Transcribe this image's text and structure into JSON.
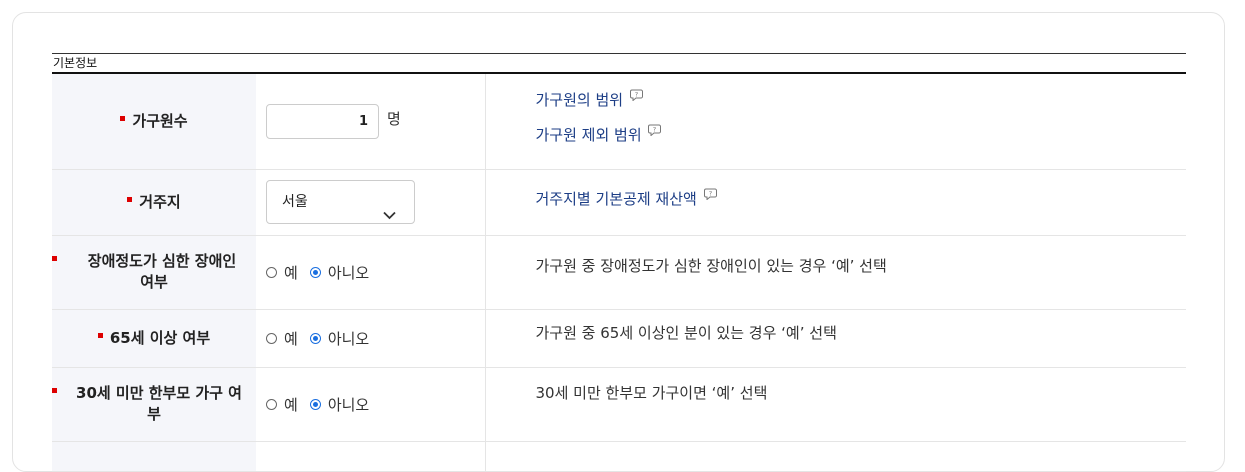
{
  "section": {
    "title": "기본정보"
  },
  "rows": [
    {
      "label": "가구원수",
      "value": "1",
      "unit": "명",
      "links": [
        "가구원의 범위",
        "가구원 제외 범위"
      ]
    },
    {
      "label": "거주지",
      "selected": "서울",
      "links": [
        "거주지별 기본공제 재산액"
      ]
    },
    {
      "label_line1": "장애정도가 심한 장애인",
      "label_line2": "여부",
      "yes": "예",
      "no": "아니오",
      "desc": "가구원 중 장애정도가 심한 장애인이 있는 경우 ‘예’ 선택"
    },
    {
      "label": "65세 이상 여부",
      "yes": "예",
      "no": "아니오",
      "desc": "가구원 중 65세 이상인 분이 있는 경우 ‘예’ 선택"
    },
    {
      "label_line1": "30세 미만 한부모 가구 여",
      "label_line2": "부",
      "yes": "예",
      "no": "아니오",
      "desc": "30세 미만 한부모 가구이면 ‘예’ 선택"
    }
  ],
  "icons": {
    "help": "question-bubble-icon",
    "dropdown": "chevron-down-icon"
  },
  "colors": {
    "accent": "#1a6fe0",
    "link": "#1d3e86",
    "required": "#dd0000"
  }
}
